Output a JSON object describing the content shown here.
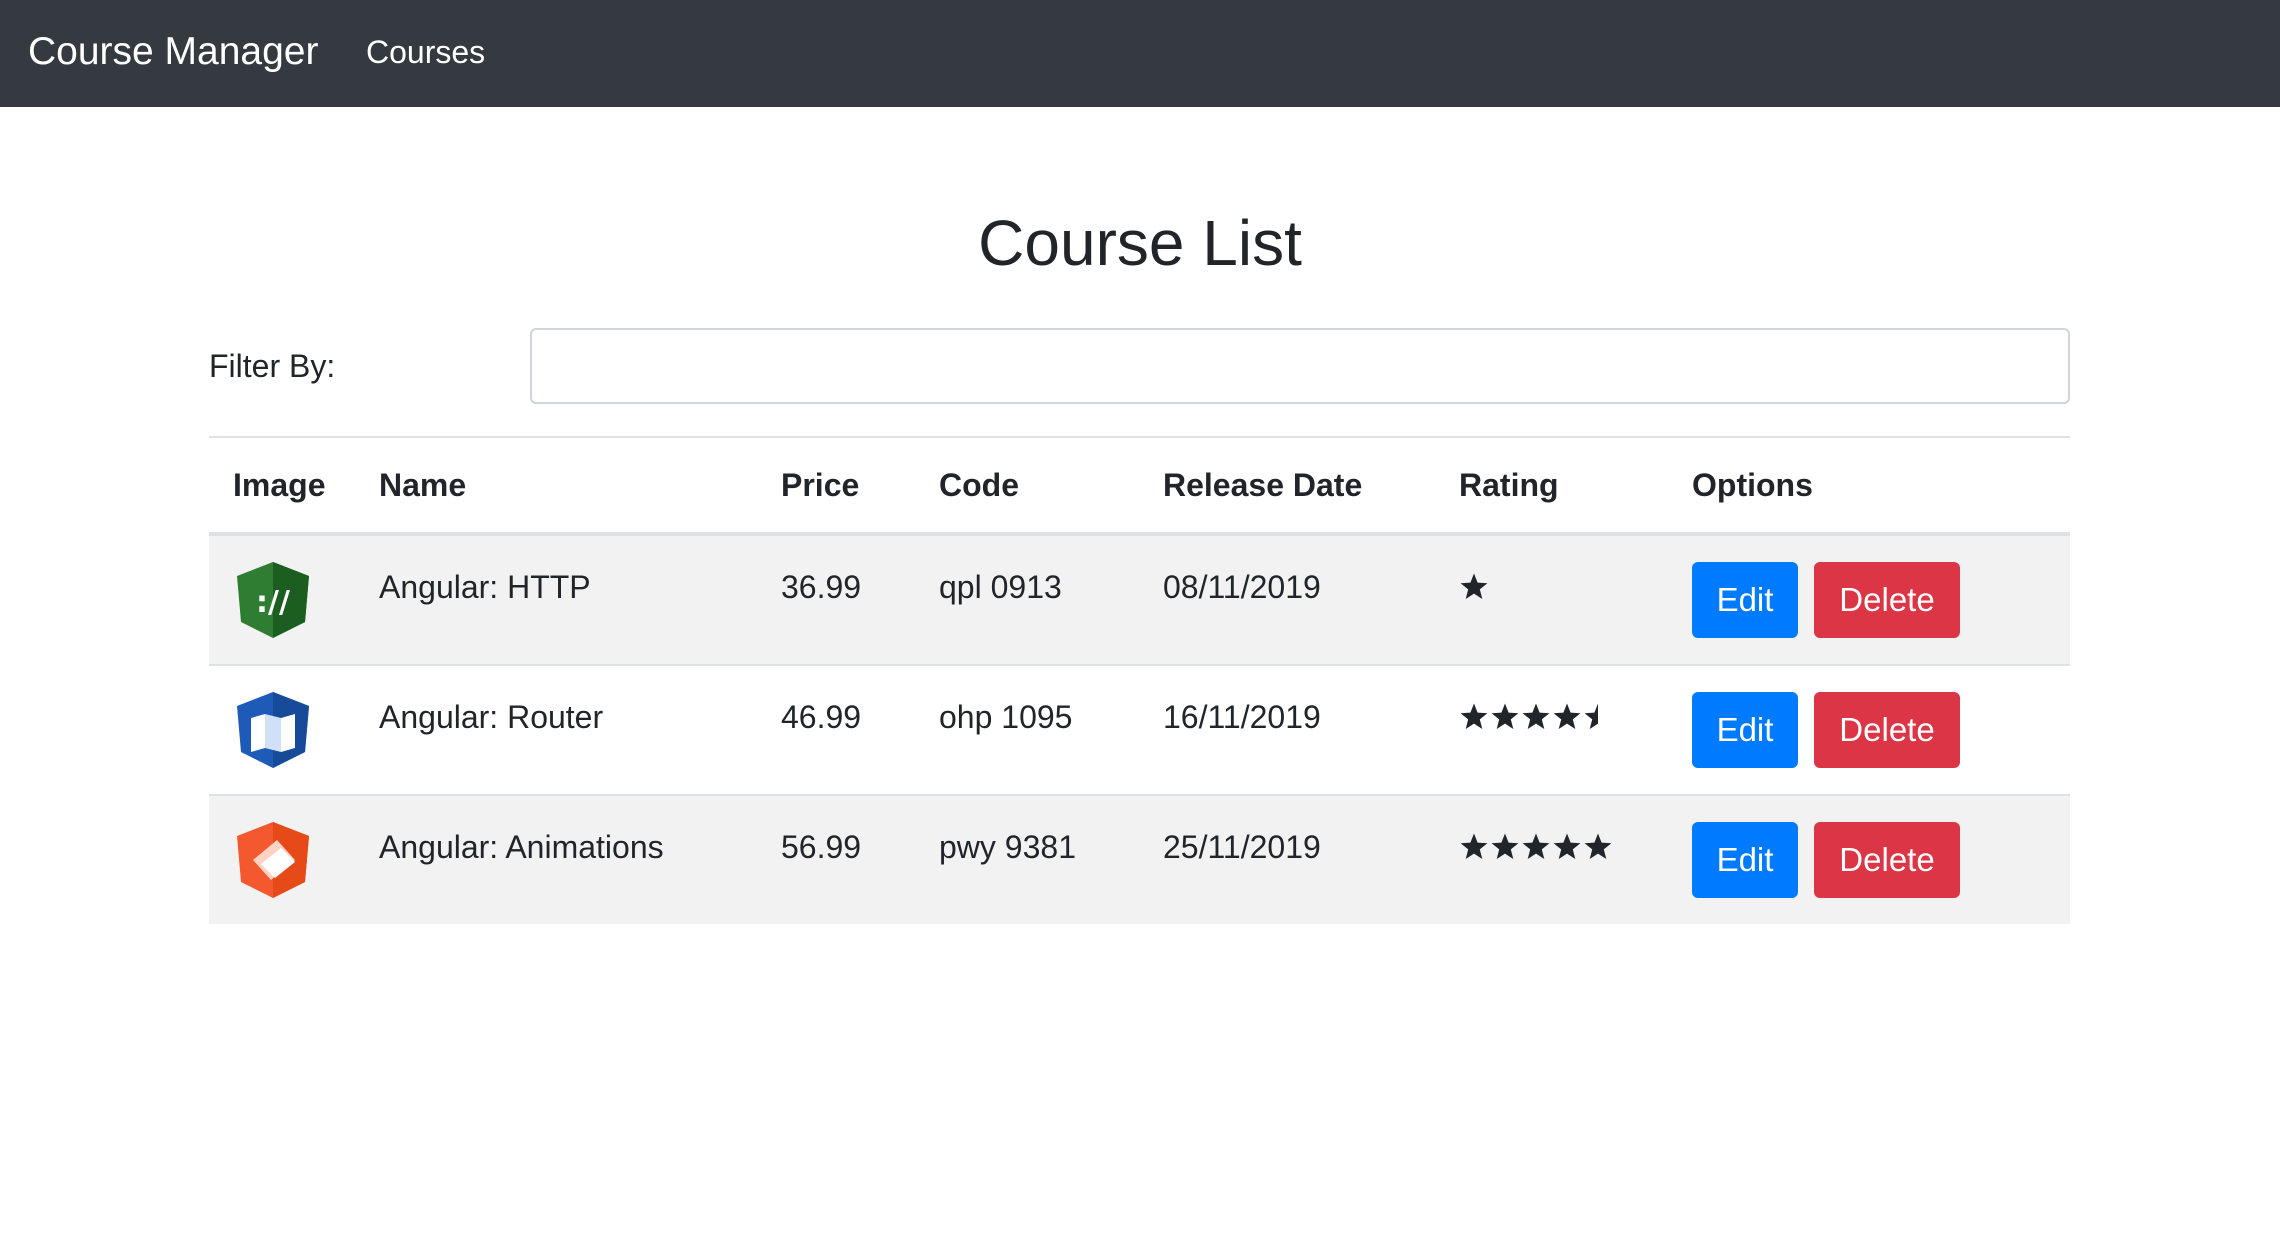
{
  "navbar": {
    "brand": "Course Manager",
    "links": [
      "Courses"
    ]
  },
  "page": {
    "title": "Course List",
    "filter_label": "Filter By:",
    "filter_value": ""
  },
  "table": {
    "headers": [
      "Image",
      "Name",
      "Price",
      "Code",
      "Release Date",
      "Rating",
      "Options"
    ],
    "rows": [
      {
        "image_icon": "angular-http-logo-icon",
        "name": "Angular: HTTP",
        "price": "36.99",
        "code": "qpl 0913",
        "release_date": "08/11/2019",
        "rating": 1,
        "edit_label": "Edit",
        "delete_label": "Delete"
      },
      {
        "image_icon": "angular-router-logo-icon",
        "name": "Angular: Router",
        "price": "46.99",
        "code": "ohp 1095",
        "release_date": "16/11/2019",
        "rating": 4.5,
        "edit_label": "Edit",
        "delete_label": "Delete"
      },
      {
        "image_icon": "angular-animations-logo-icon",
        "name": "Angular: Animations",
        "price": "56.99",
        "code": "pwy 9381",
        "release_date": "25/11/2019",
        "rating": 5,
        "edit_label": "Edit",
        "delete_label": "Delete"
      }
    ]
  },
  "colors": {
    "navbar_bg": "#343a40",
    "edit_button": "#007bff",
    "delete_button": "#dc3545",
    "stripe": "#f2f2f2",
    "http_logo": "#2e7d32",
    "router_logo": "#1e5bb8",
    "animations_logo": "#f4582e"
  }
}
